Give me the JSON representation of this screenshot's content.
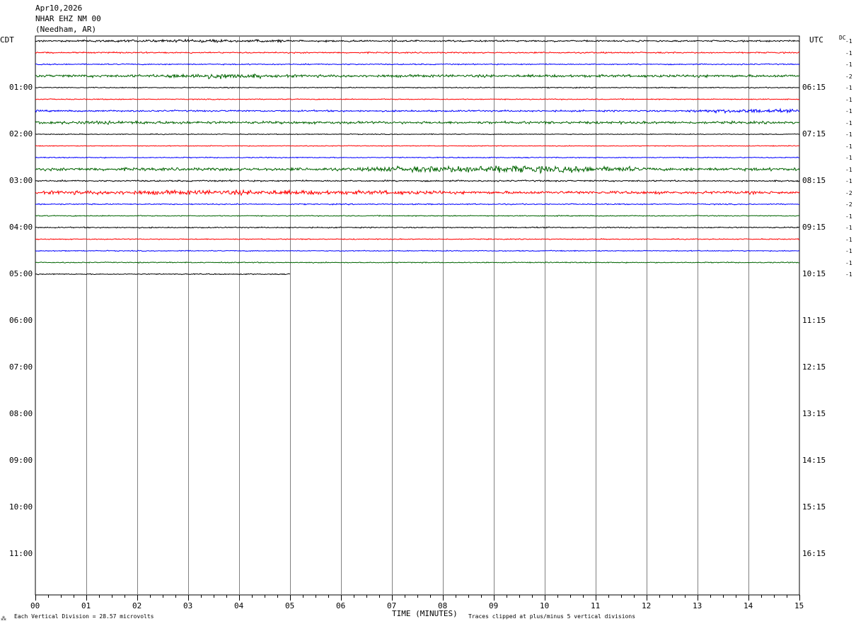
{
  "header": {
    "date": "Apr10,2026",
    "station": "NHAR EHZ NM 00",
    "location": "(Needham, AR)"
  },
  "axes": {
    "left_zone": "CDT",
    "right_zone": "UTC",
    "dc_label": "DC",
    "x_title": "TIME (MINUTES)"
  },
  "footer": {
    "vertical_division": "Each Vertical Division =   28.57 microvolts",
    "clip_note": "Traces clipped at plus/minus 5 vertical divisions",
    "corner_mark": "⁂"
  },
  "chart_data": {
    "type": "line",
    "title": "",
    "xlabel": "TIME (MINUTES)",
    "ylabel": "",
    "xlim": [
      0,
      15
    ],
    "x_ticks": [
      "00",
      "01",
      "02",
      "03",
      "04",
      "05",
      "06",
      "07",
      "08",
      "09",
      "10",
      "11",
      "12",
      "13",
      "14",
      "15"
    ],
    "minor_ticks_per_minute": 4,
    "rows_per_hour": 4,
    "row_minutes": 15,
    "left_hour_labels": [
      "01:00",
      "02:00",
      "03:00",
      "04:00",
      "05:00",
      "06:00",
      "07:00",
      "08:00",
      "09:00",
      "10:00",
      "11:00"
    ],
    "right_hour_labels": [
      "06:15",
      "07:15",
      "08:15",
      "09:15",
      "10:15",
      "11:15",
      "12:15",
      "13:15",
      "14:15",
      "15:15",
      "16:15"
    ],
    "total_rows": 48,
    "colors": [
      "#000000",
      "#ff0000",
      "#0000ff",
      "#006400"
    ],
    "dc_offsets": [
      -1,
      -1,
      -1,
      -2,
      -1,
      -1,
      -1,
      -1,
      -1,
      -1,
      -1,
      -1,
      -1,
      -2,
      -2,
      -1,
      -1,
      -1,
      -1,
      -1,
      -1
    ],
    "trace_amplitude": [
      1.0,
      0.8,
      0.7,
      1.6,
      0.6,
      0.6,
      1.0,
      1.5,
      0.5,
      0.5,
      0.6,
      1.8,
      0.9,
      1.7,
      0.7,
      0.6,
      0.7,
      0.6,
      0.6,
      0.6,
      0.6
    ],
    "last_row_end_minute": 5.0,
    "bursts": [
      {
        "row": 0,
        "start": 1.5,
        "end": 5.0,
        "gain": 1.8
      },
      {
        "row": 3,
        "start": 2.5,
        "end": 4.5,
        "gain": 2.2
      },
      {
        "row": 6,
        "start": 12.8,
        "end": 15.0,
        "gain": 2.6
      },
      {
        "row": 7,
        "start": 0.0,
        "end": 3.0,
        "gain": 1.4
      },
      {
        "row": 11,
        "start": 6.5,
        "end": 11.8,
        "gain": 2.6
      },
      {
        "row": 13,
        "start": 0.3,
        "end": 8.0,
        "gain": 1.7
      }
    ]
  }
}
